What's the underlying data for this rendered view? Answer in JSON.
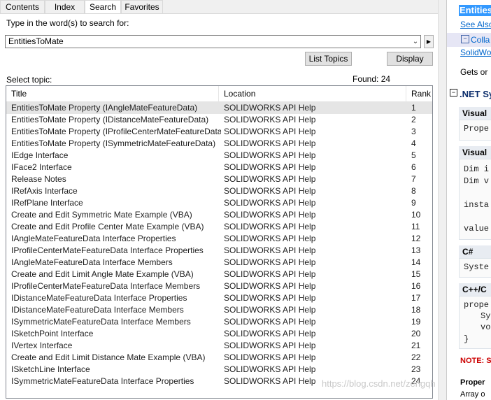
{
  "tabs": [
    {
      "label": "Contents"
    },
    {
      "label": "Index"
    },
    {
      "label": "Search"
    },
    {
      "label": "Favorites"
    }
  ],
  "search": {
    "prompt_label": "Type in the word(s) to search for:",
    "query": "EntitiesToMate",
    "list_topics_label": "List Topics",
    "display_label": "Display",
    "select_topic_label": "Select topic:",
    "found_label": "Found: 24"
  },
  "table": {
    "columns": [
      "Title",
      "Location",
      "Rank"
    ],
    "rows": [
      {
        "title": "EntitiesToMate Property (IAngleMateFeatureData)",
        "location": "SOLIDWORKS API Help",
        "rank": "1"
      },
      {
        "title": "EntitiesToMate Property (IDistanceMateFeatureData)",
        "location": "SOLIDWORKS API Help",
        "rank": "2"
      },
      {
        "title": "EntitiesToMate Property (IProfileCenterMateFeatureData)",
        "location": "SOLIDWORKS API Help",
        "rank": "3"
      },
      {
        "title": "EntitiesToMate Property (ISymmetricMateFeatureData)",
        "location": "SOLIDWORKS API Help",
        "rank": "4"
      },
      {
        "title": "IEdge Interface",
        "location": "SOLIDWORKS API Help",
        "rank": "5"
      },
      {
        "title": "IFace2 Interface",
        "location": "SOLIDWORKS API Help",
        "rank": "6"
      },
      {
        "title": "Release Notes",
        "location": "SOLIDWORKS API Help",
        "rank": "7"
      },
      {
        "title": "IRefAxis Interface",
        "location": "SOLIDWORKS API Help",
        "rank": "8"
      },
      {
        "title": "IRefPlane Interface",
        "location": "SOLIDWORKS API Help",
        "rank": "9"
      },
      {
        "title": "Create and Edit Symmetric Mate Example (VBA)",
        "location": "SOLIDWORKS API Help",
        "rank": "10"
      },
      {
        "title": "Create and Edit Profile Center Mate Example (VBA)",
        "location": "SOLIDWORKS API Help",
        "rank": "11"
      },
      {
        "title": "IAngleMateFeatureData Interface Properties",
        "location": "SOLIDWORKS API Help",
        "rank": "12"
      },
      {
        "title": "IProfileCenterMateFeatureData Interface Properties",
        "location": "SOLIDWORKS API Help",
        "rank": "13"
      },
      {
        "title": "IAngleMateFeatureData Interface Members",
        "location": "SOLIDWORKS API Help",
        "rank": "14"
      },
      {
        "title": "Create and Edit Limit Angle Mate Example (VBA)",
        "location": "SOLIDWORKS API Help",
        "rank": "15"
      },
      {
        "title": "IProfileCenterMateFeatureData Interface Members",
        "location": "SOLIDWORKS API Help",
        "rank": "16"
      },
      {
        "title": "IDistanceMateFeatureData Interface Properties",
        "location": "SOLIDWORKS API Help",
        "rank": "17"
      },
      {
        "title": "IDistanceMateFeatureData Interface Members",
        "location": "SOLIDWORKS API Help",
        "rank": "18"
      },
      {
        "title": "ISymmetricMateFeatureData Interface Members",
        "location": "SOLIDWORKS API Help",
        "rank": "19"
      },
      {
        "title": "ISketchPoint Interface",
        "location": "SOLIDWORKS API Help",
        "rank": "20"
      },
      {
        "title": "IVertex Interface",
        "location": "SOLIDWORKS API Help",
        "rank": "21"
      },
      {
        "title": "Create and Edit Limit Distance Mate Example (VBA)",
        "location": "SOLIDWORKS API Help",
        "rank": "22"
      },
      {
        "title": "ISketchLine Interface",
        "location": "SOLIDWORKS API Help",
        "rank": "23"
      },
      {
        "title": "ISymmetricMateFeatureData Interface Properties",
        "location": "SOLIDWORKS API Help",
        "rank": "24"
      }
    ]
  },
  "content_pane": {
    "page_title": "Entities",
    "see_also": "See Also",
    "collapse": "Colla",
    "solidworks_link": "SolidWo",
    "gets_text": "Gets or",
    "net_syntax": ".NET Sy",
    "visual_basic_1": "Visual",
    "code_1": "Prope",
    "visual_basic_2": "Visual",
    "code_2a": "Dim i",
    "code_2b": "Dim v",
    "code_2c": "insta",
    "code_2d": "value",
    "csharp": "C#",
    "code_3": "Syste",
    "cpp": "C++/C",
    "code_4a": "prope",
    "code_4b": "Sy",
    "code_4c": "vo",
    "code_4d": "}",
    "note": "NOTE: S",
    "property_value": "Proper",
    "array_text": "Array o"
  },
  "watermark": "https://blog.csdn.net/zengqh",
  "colors": {
    "selected_tab": "#ffffff",
    "row_highlight": "#e5e5e5",
    "link_blue": "#0066cc",
    "note_red": "#cc0000",
    "title_highlight_bg": "#3399ff"
  }
}
